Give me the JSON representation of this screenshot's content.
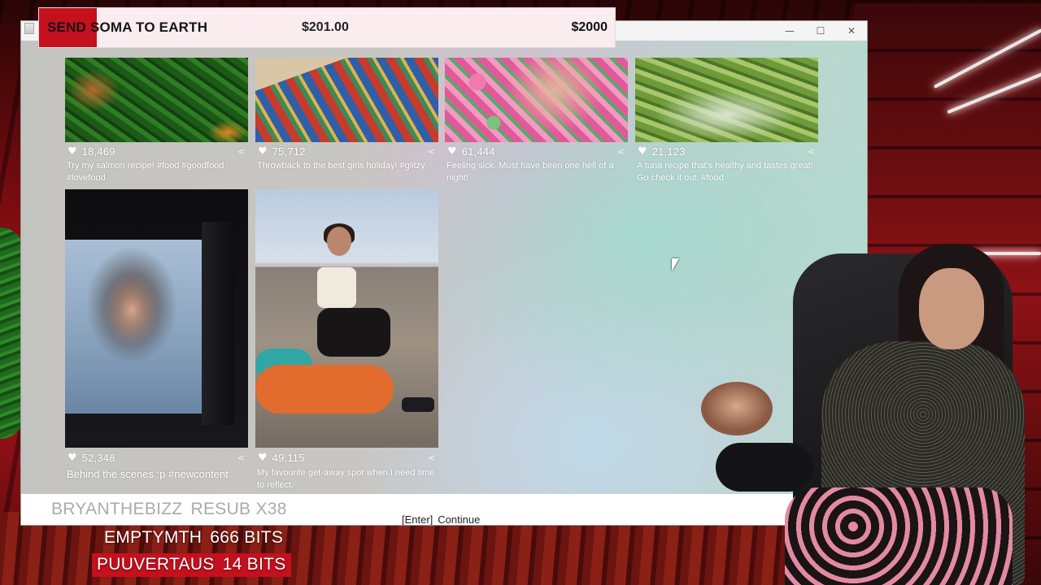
{
  "stream_goal": {
    "title": "SEND SOMA TO EARTH",
    "current": "$201.00",
    "target": "$2000",
    "progress_fraction": 0.1005,
    "fill_color": "#c5101e"
  },
  "window": {
    "controls": [
      "—",
      "☐",
      "✕"
    ]
  },
  "posts": [
    {
      "likes": "18,469",
      "caption": "Try my salmon recipe! #food #goodfood #lovefood"
    },
    {
      "likes": "75,712",
      "caption": "Throwback to the best girls holiday! #glitzy"
    },
    {
      "likes": "61,444",
      "caption": "Feeling sick. Must have been one hell of a night!"
    },
    {
      "likes": "21,123",
      "caption": "A tuna recipe that's healthy and tastes great! Go check it out. #food"
    },
    {
      "likes": "52,348",
      "caption": "Behind the scenes :p #newcontent"
    },
    {
      "likes": "49,115",
      "caption": "My favourite get-away spot when I need time to reflect."
    }
  ],
  "icons": {
    "heart": "heart-icon",
    "share": "share-icon"
  },
  "footer": {
    "key": "[Enter]",
    "action": "Continue"
  },
  "alerts": [
    {
      "name": "BRYANTHEBIZZ",
      "detail": "RESUB X38"
    },
    {
      "name": "EMPTYMTH",
      "detail": "666 BITS"
    },
    {
      "name": "PUUVERTAUS",
      "detail": "14 BITS"
    }
  ]
}
